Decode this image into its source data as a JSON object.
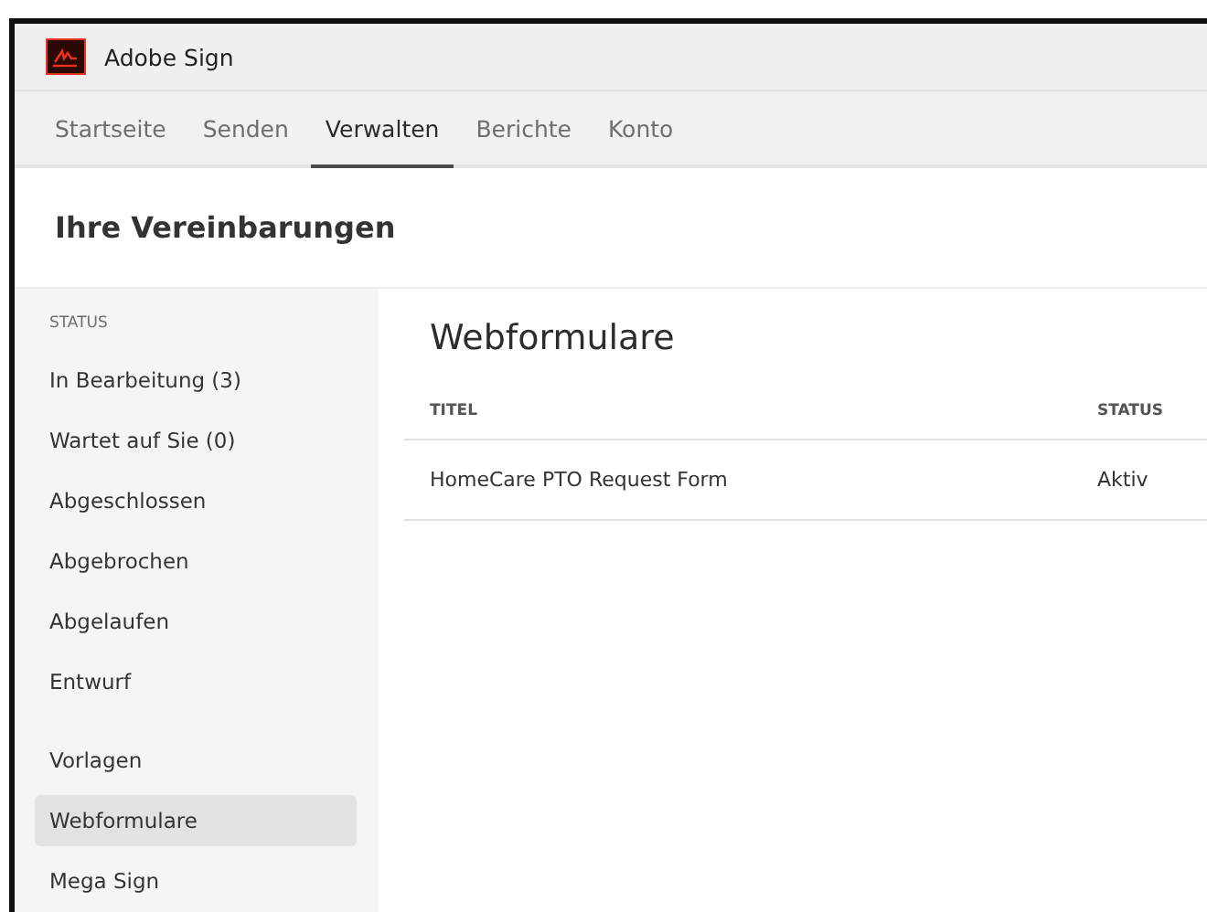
{
  "app": {
    "title": "Adobe Sign"
  },
  "tabs": [
    {
      "label": "Startseite",
      "selected": false
    },
    {
      "label": "Senden",
      "selected": false
    },
    {
      "label": "Verwalten",
      "selected": true
    },
    {
      "label": "Berichte",
      "selected": false
    },
    {
      "label": "Konto",
      "selected": false
    }
  ],
  "page_title": "Ihre Vereinbarungen",
  "sidebar": {
    "heading": "STATUS",
    "status_items": [
      {
        "label": "In Bearbeitung (3)",
        "selected": false
      },
      {
        "label": "Wartet auf Sie (0)",
        "selected": false
      },
      {
        "label": "Abgeschlossen",
        "selected": false
      },
      {
        "label": "Abgebrochen",
        "selected": false
      },
      {
        "label": "Abgelaufen",
        "selected": false
      },
      {
        "label": "Entwurf",
        "selected": false
      }
    ],
    "other_items": [
      {
        "label": "Vorlagen",
        "selected": false
      },
      {
        "label": "Webformulare",
        "selected": true
      },
      {
        "label": "Mega Sign",
        "selected": false
      }
    ]
  },
  "content": {
    "heading": "Webformulare",
    "table": {
      "columns": [
        "TITEL",
        "STATUS"
      ],
      "rows": [
        [
          "HomeCare PTO Request Form",
          "Aktiv"
        ]
      ]
    }
  }
}
